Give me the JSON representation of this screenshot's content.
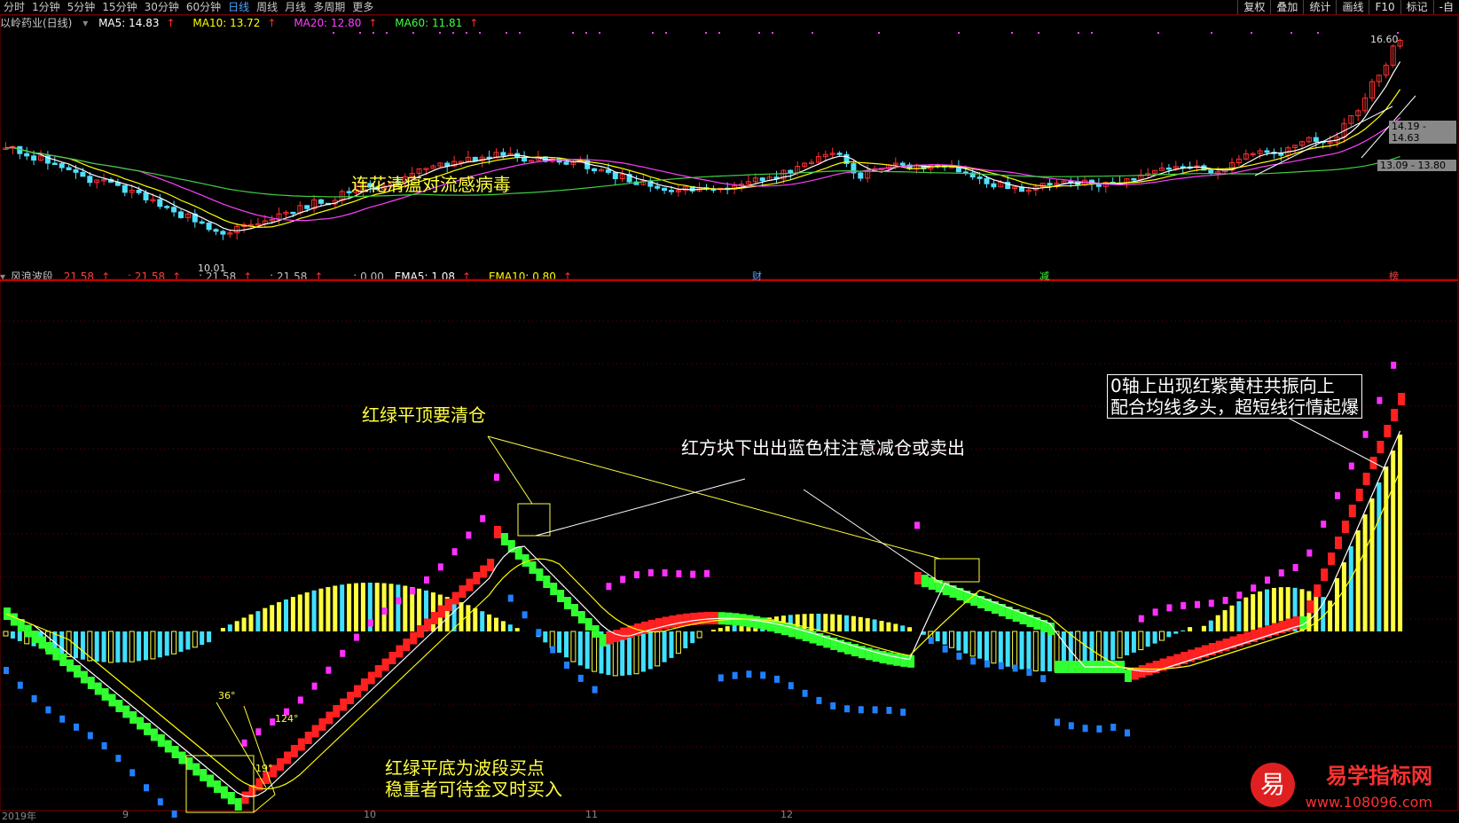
{
  "periods": [
    "分时",
    "1分钟",
    "5分钟",
    "15分钟",
    "30分钟",
    "60分钟",
    "日线",
    "周线",
    "月线",
    "多周期",
    "更多"
  ],
  "active_period": "日线",
  "right_buttons": [
    "复权",
    "叠加",
    "统计",
    "画线",
    "F10",
    "标记",
    "-自"
  ],
  "stock_title": "以岭药业(日线)",
  "ma": [
    {
      "label": "MA5: 14.83",
      "color": "#ffffff"
    },
    {
      "label": "MA10: 13.72",
      "color": "#ffff00"
    },
    {
      "label": "MA20: 12.80",
      "color": "#ff40ff"
    },
    {
      "label": "MA60: 11.81",
      "color": "#40ff40"
    }
  ],
  "price_labels": {
    "high": "16.60",
    "low": "10.01",
    "range1": "14.19 - 14.63",
    "range2": "13.09 - 13.80"
  },
  "event_markers": [
    "财",
    "减",
    "榜"
  ],
  "indicator_title": "风浪波段",
  "indicator_values": [
    {
      "label": "21.58",
      "color": "#ff4040"
    },
    {
      "label": ": 21.58",
      "color": "#ff4040"
    },
    {
      "label": ": 21.58",
      "color": "#c0c0c0"
    },
    {
      "label": ": 21.58",
      "color": "#c0c0c0"
    },
    {
      "label": ": 0.00",
      "color": "#c0c0c0"
    },
    {
      "label": "EMA5: 1.08",
      "color": "#ffffff"
    },
    {
      "label": "EMA10: 0.80",
      "color": "#ffff00"
    }
  ],
  "annotations": {
    "lianhua": "连花清瘟对流感病毒",
    "top_clear": "红绿平顶要清仓",
    "red_block": "红方块下出出蓝色柱注意减仓或卖出",
    "bottom_buy_1": "红绿平底为波段买点",
    "bottom_buy_2": "稳重者可待金叉时买入",
    "resonance_1": "0轴上出现红紫黄柱共振向上",
    "resonance_2": "配合均线多头，超短线行情起爆",
    "angle_36": "36°",
    "angle_124": "124°",
    "angle_19": "19°"
  },
  "watermark": {
    "name": "易学指标网",
    "url": "www.108096.com",
    "logo": "易"
  },
  "bottom_axis": [
    "2019年",
    "9",
    "10",
    "11",
    "12"
  ]
}
